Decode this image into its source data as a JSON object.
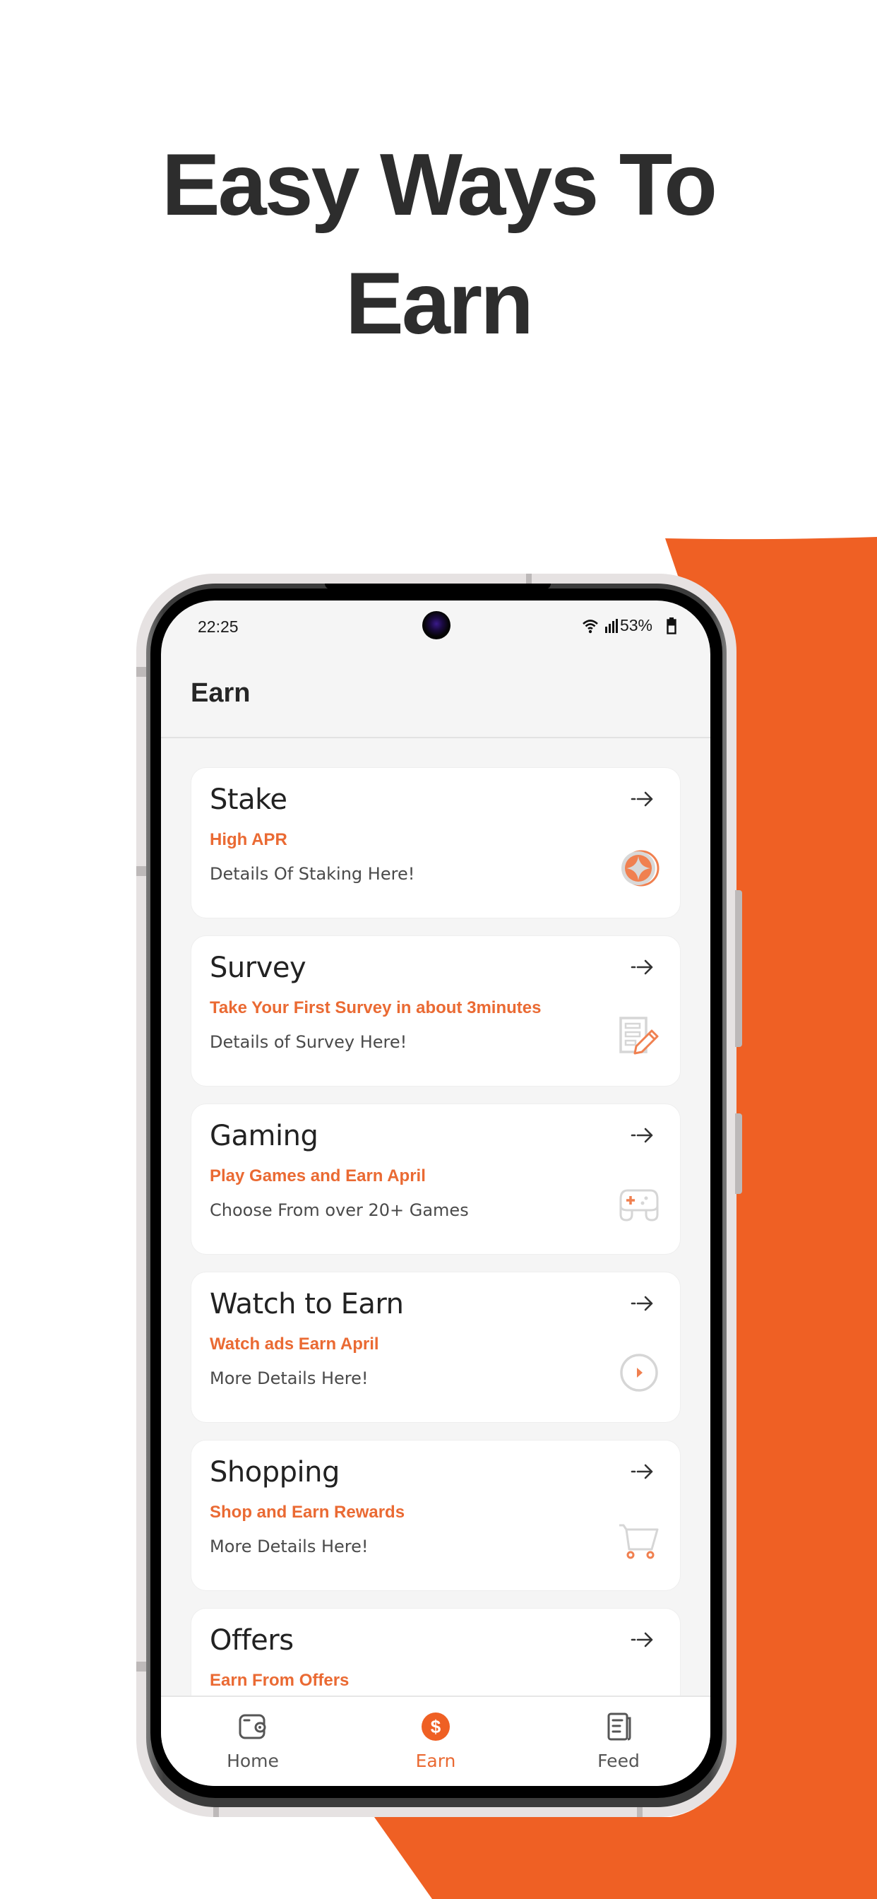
{
  "headline": {
    "line1": "Easy Ways To",
    "line2": "Earn"
  },
  "colors": {
    "accent": "#ef6024",
    "text_dark": "#2d2d2d",
    "subtitle": "#ea6a33"
  },
  "status_bar": {
    "time": "22:25",
    "battery": "53%",
    "icons": [
      "wifi-icon",
      "signal-icon",
      "battery-icon"
    ]
  },
  "app": {
    "title": "Earn"
  },
  "cards": [
    {
      "title": "Stake",
      "subtitle": "High APR",
      "description": "Details Of Staking Here!",
      "icon": "coin-icon"
    },
    {
      "title": "Survey",
      "subtitle": "Take Your  First Survey in about 3minutes",
      "description": "Details of Survey Here!",
      "icon": "survey-icon"
    },
    {
      "title": "Gaming",
      "subtitle": "Play Games and Earn April",
      "description": "Choose From over 20+ Games",
      "icon": "gamepad-icon"
    },
    {
      "title": "Watch to Earn",
      "subtitle": "Watch ads Earn April",
      "description": "More Details Here!",
      "icon": "play-icon"
    },
    {
      "title": "Shopping",
      "subtitle": "Shop and Earn Rewards",
      "description": "More Details Here!",
      "icon": "cart-icon"
    },
    {
      "title": "Offers",
      "subtitle": "Earn From Offers",
      "description": "",
      "icon": ""
    }
  ],
  "bottom_nav": {
    "items": [
      {
        "label": "Home",
        "icon": "wallet-icon",
        "active": false
      },
      {
        "label": "Earn",
        "icon": "dollar-icon",
        "active": true
      },
      {
        "label": "Feed",
        "icon": "news-icon",
        "active": false
      }
    ]
  }
}
